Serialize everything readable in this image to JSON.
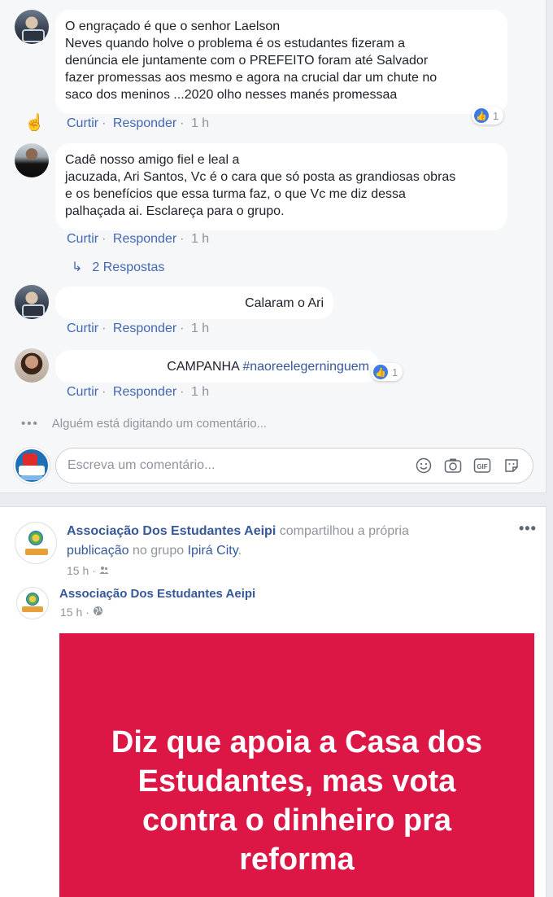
{
  "comments": [
    {
      "text": "O engraçado é que o senhor Laelson\nNeves quando holve o problema é os estudantes fizeram a\ndenúncia ele juntamente com o PREFEITO foram até Salvador\nfazer promessas aos mesmo e agora na crucial dar um chute no\nsaco dos meninos ...2020 olho nesses manés promessaa",
      "like": "Curtir",
      "reply": "Responder",
      "time": "1 h",
      "reaction_count": "1"
    },
    {
      "text": "Cadê nosso amigo fiel e leal a\njacuzada, Ari Santos, Vc é o cara que só posta as grandiosas obras\ne os benefícios que essa turma faz, o que Vc me diz dessa\npalhaçada ai. Esclareça para o grupo.",
      "like": "Curtir",
      "reply": "Responder",
      "time": "1 h",
      "replies_label": "2 Respostas"
    },
    {
      "text": "Calaram o Ari",
      "like": "Curtir",
      "reply": "Responder",
      "time": "1 h"
    },
    {
      "text_prefix": "CAMPANHA ",
      "hashtag": "#naoreelegerninguem",
      "like": "Curtir",
      "reply": "Responder",
      "time": "1 h",
      "reaction_count": "1"
    }
  ],
  "separator": "·",
  "typing": {
    "dots": "•••",
    "text": "Alguém está digitando um comentário..."
  },
  "comment_box": {
    "placeholder": "Escreva um comentário...",
    "icons": [
      "emoji-icon",
      "camera-icon",
      "gif-icon",
      "sticker-icon"
    ],
    "gif_label": "GIF"
  },
  "post": {
    "author": "Associação Dos Estudantes Aeipi",
    "action_text": " compartilhou a própria ",
    "publication_link": "publicação",
    "group_text": " no grupo ",
    "group_name": "Ipirá City",
    "period": ".",
    "time": "15 h",
    "more": "•••",
    "original_author": "Associação Dos Estudantes Aeipi",
    "original_time": "15 h",
    "image_text": "Diz que apoia a Casa dos\nEstudantes, mas vota\ncontra o dinheiro pra\nreforma",
    "image_color": "#dc1645"
  },
  "colors": {
    "link": "#4267b2",
    "like_blue": "#3b7be8",
    "muted": "#90949c"
  }
}
